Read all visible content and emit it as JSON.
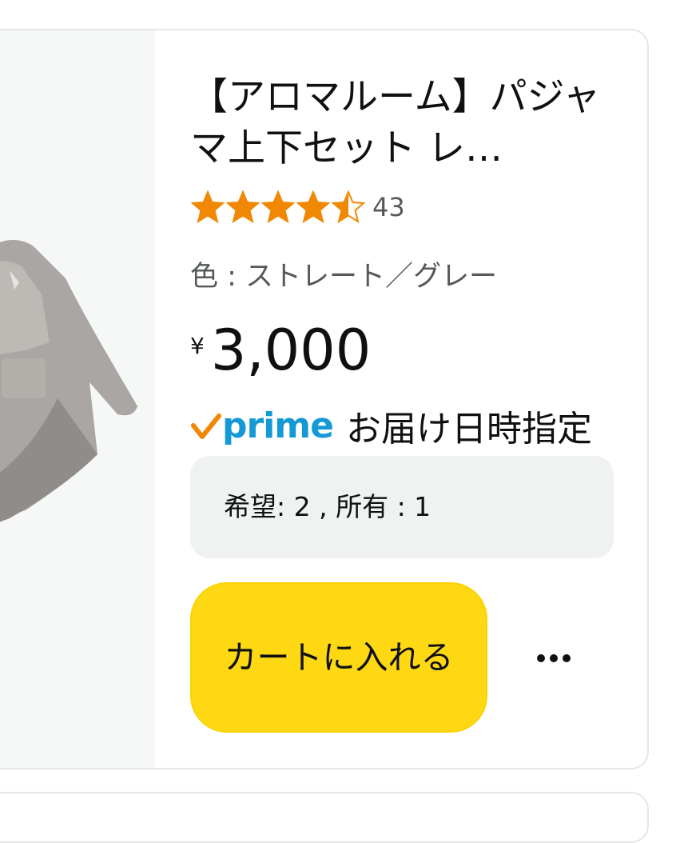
{
  "product": {
    "title": "【アロマルーム】パジャマ上下セット レ…",
    "rating": 4.5,
    "rating_max": 5,
    "rating_count": "43",
    "variant": "色 : ストレート／グレー",
    "price_symbol": "¥",
    "price_value": "3,000",
    "prime_label": "prime",
    "delivery_text": "お届け日時指定",
    "wishlist_text": "希望: 2 , 所有 : 1",
    "cart_button_label": "カートに入れる"
  },
  "colors": {
    "star": "#f08804",
    "prime_blue": "#1399d5",
    "prime_check": "#f08804",
    "cart_button": "#ffd814",
    "wish_box": "#f0f2f2"
  },
  "icons": {
    "more": "more-horizontal-icon",
    "prime_check": "check-icon"
  }
}
